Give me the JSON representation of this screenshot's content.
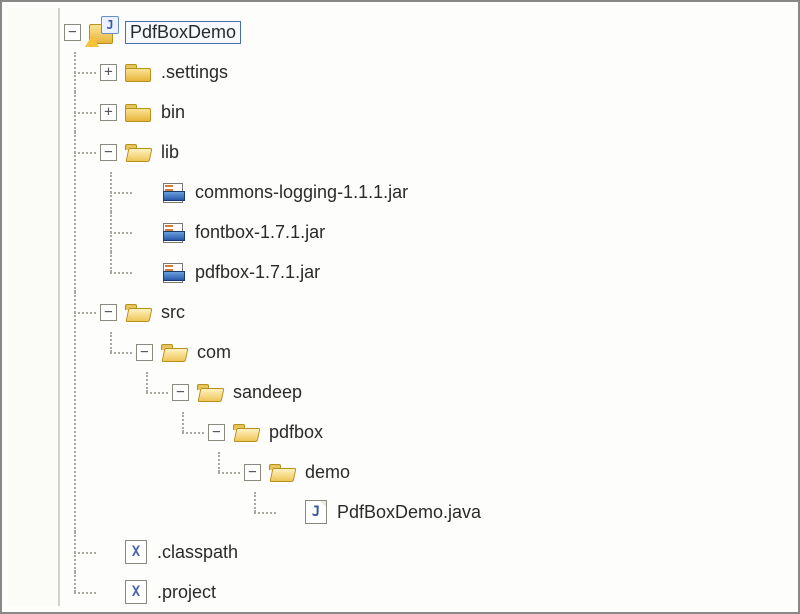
{
  "root": {
    "name": "PdfBoxDemo",
    "selected": true
  },
  "settings": ".settings",
  "bin": "bin",
  "lib": {
    "name": "lib",
    "jars": [
      "commons-logging-1.1.1.jar",
      "fontbox-1.7.1.jar",
      "pdfbox-1.7.1.jar"
    ]
  },
  "src": {
    "name": "src",
    "pkg0": "com",
    "pkg1": "sandeep",
    "pkg2": "pdfbox",
    "pkg3": "demo",
    "file": "PdfBoxDemo.java"
  },
  "classpath": ".classpath",
  "project": ".project"
}
